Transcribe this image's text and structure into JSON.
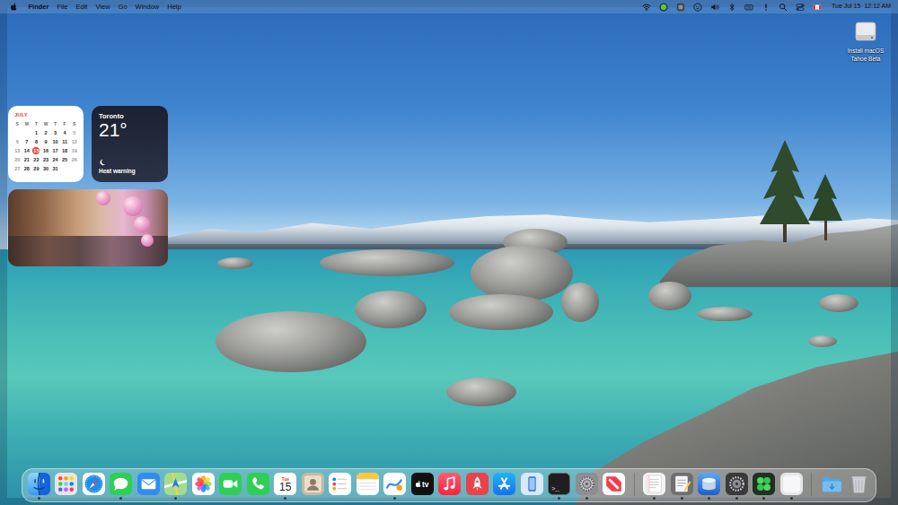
{
  "menu_bar": {
    "menus": [
      {
        "label": "Finder",
        "kind": "app"
      },
      {
        "label": "File",
        "kind": "menu"
      },
      {
        "label": "Edit",
        "kind": "menu"
      },
      {
        "label": "View",
        "kind": "menu"
      },
      {
        "label": "Go",
        "kind": "menu"
      },
      {
        "label": "Window",
        "kind": "menu"
      },
      {
        "label": "Help",
        "kind": "menu"
      }
    ],
    "status_items": [
      {
        "kind": "wifi"
      },
      {
        "kind": "greenapp"
      },
      {
        "kind": "darkapp"
      },
      {
        "kind": "smiley"
      },
      {
        "kind": "volume"
      },
      {
        "kind": "bluetooth"
      },
      {
        "kind": "keyboard"
      },
      {
        "kind": "alert"
      },
      {
        "kind": "search"
      },
      {
        "kind": "controlcenter"
      },
      {
        "kind": "flag"
      }
    ],
    "clock": {
      "date": "Tue Jul 15",
      "time": "12:12 AM"
    }
  },
  "desktop_items": [
    {
      "label": "Install macOS Tahoe Beta",
      "selected": false
    }
  ],
  "widgets": {
    "calendar": {
      "month": "JULY",
      "weekdays": [
        "S",
        "M",
        "T",
        "W",
        "T",
        "F",
        "S"
      ],
      "weeks": [
        [
          null,
          null,
          {
            "day": "1",
            "dimmed": false,
            "selected": false
          },
          {
            "day": "2",
            "dimmed": false,
            "selected": false
          },
          {
            "day": "3",
            "dimmed": false,
            "selected": false
          },
          {
            "day": "4",
            "dimmed": false,
            "selected": false
          },
          {
            "day": "5",
            "dimmed": true,
            "selected": false
          }
        ],
        [
          {
            "day": "6",
            "dimmed": true,
            "selected": false
          },
          {
            "day": "7",
            "dimmed": false,
            "selected": false
          },
          {
            "day": "8",
            "dimmed": false,
            "selected": false
          },
          {
            "day": "9",
            "dimmed": false,
            "selected": false
          },
          {
            "day": "10",
            "dimmed": false,
            "selected": false
          },
          {
            "day": "11",
            "dimmed": false,
            "selected": false
          },
          {
            "day": "12",
            "dimmed": true,
            "selected": false
          }
        ],
        [
          {
            "day": "13",
            "dimmed": true,
            "selected": false
          },
          {
            "day": "14",
            "dimmed": false,
            "selected": false
          },
          {
            "day": "15",
            "dimmed": false,
            "selected": true
          },
          {
            "day": "16",
            "dimmed": false,
            "selected": false
          },
          {
            "day": "17",
            "dimmed": false,
            "selected": false
          },
          {
            "day": "18",
            "dimmed": false,
            "selected": false
          },
          {
            "day": "19",
            "dimmed": true,
            "selected": false
          }
        ],
        [
          {
            "day": "20",
            "dimmed": true,
            "selected": false
          },
          {
            "day": "21",
            "dimmed": false,
            "selected": false
          },
          {
            "day": "22",
            "dimmed": false,
            "selected": false
          },
          {
            "day": "23",
            "dimmed": false,
            "selected": false
          },
          {
            "day": "24",
            "dimmed": false,
            "selected": false
          },
          {
            "day": "25",
            "dimmed": false,
            "selected": false
          },
          {
            "day": "26",
            "dimmed": true,
            "selected": false
          }
        ],
        [
          {
            "day": "27",
            "dimmed": true,
            "selected": false
          },
          {
            "day": "28",
            "dimmed": false,
            "selected": false
          },
          {
            "day": "29",
            "dimmed": false,
            "selected": false
          },
          {
            "day": "30",
            "dimmed": false,
            "selected": false
          },
          {
            "day": "31",
            "dimmed": false,
            "selected": false
          },
          null,
          null
        ]
      ]
    },
    "weather": {
      "city": "Toronto",
      "temperature": "21°",
      "condition": "Heat warning"
    }
  },
  "dock": {
    "apps": [
      {
        "kind": "finder",
        "running": true
      },
      {
        "kind": "launchpad",
        "running": false
      },
      {
        "kind": "safari",
        "running": false
      },
      {
        "kind": "messages",
        "running": true
      },
      {
        "kind": "mail",
        "running": false
      },
      {
        "kind": "maps",
        "running": true
      },
      {
        "kind": "photos",
        "running": false
      },
      {
        "kind": "facetime",
        "running": false
      },
      {
        "kind": "phone",
        "running": false
      },
      {
        "kind": "calendar",
        "running": true,
        "weekday": "Tue",
        "day": "15"
      },
      {
        "kind": "contacts",
        "running": false
      },
      {
        "kind": "reminders",
        "running": false
      },
      {
        "kind": "notes",
        "running": false
      },
      {
        "kind": "freeform",
        "running": true
      },
      {
        "kind": "tv",
        "running": false,
        "label": "tv"
      },
      {
        "kind": "music",
        "running": false
      },
      {
        "kind": "rocket",
        "running": false
      },
      {
        "kind": "appstore",
        "running": false
      },
      {
        "kind": "mirroring",
        "running": false
      },
      {
        "kind": "terminal",
        "running": true,
        "label": ">_"
      },
      {
        "kind": "settings",
        "running": true
      },
      {
        "kind": "news",
        "running": false
      }
    ],
    "recent": [
      {
        "kind": "textedit",
        "running": true
      },
      {
        "kind": "scripteditor",
        "running": true
      },
      {
        "kind": "diskutility",
        "running": true
      },
      {
        "kind": "compressor",
        "running": true
      },
      {
        "kind": "puzzle",
        "running": true
      },
      {
        "kind": "blank",
        "running": true
      }
    ],
    "stacks": [
      {
        "kind": "folder",
        "running": false
      },
      {
        "kind": "trash",
        "running": false
      }
    ]
  }
}
